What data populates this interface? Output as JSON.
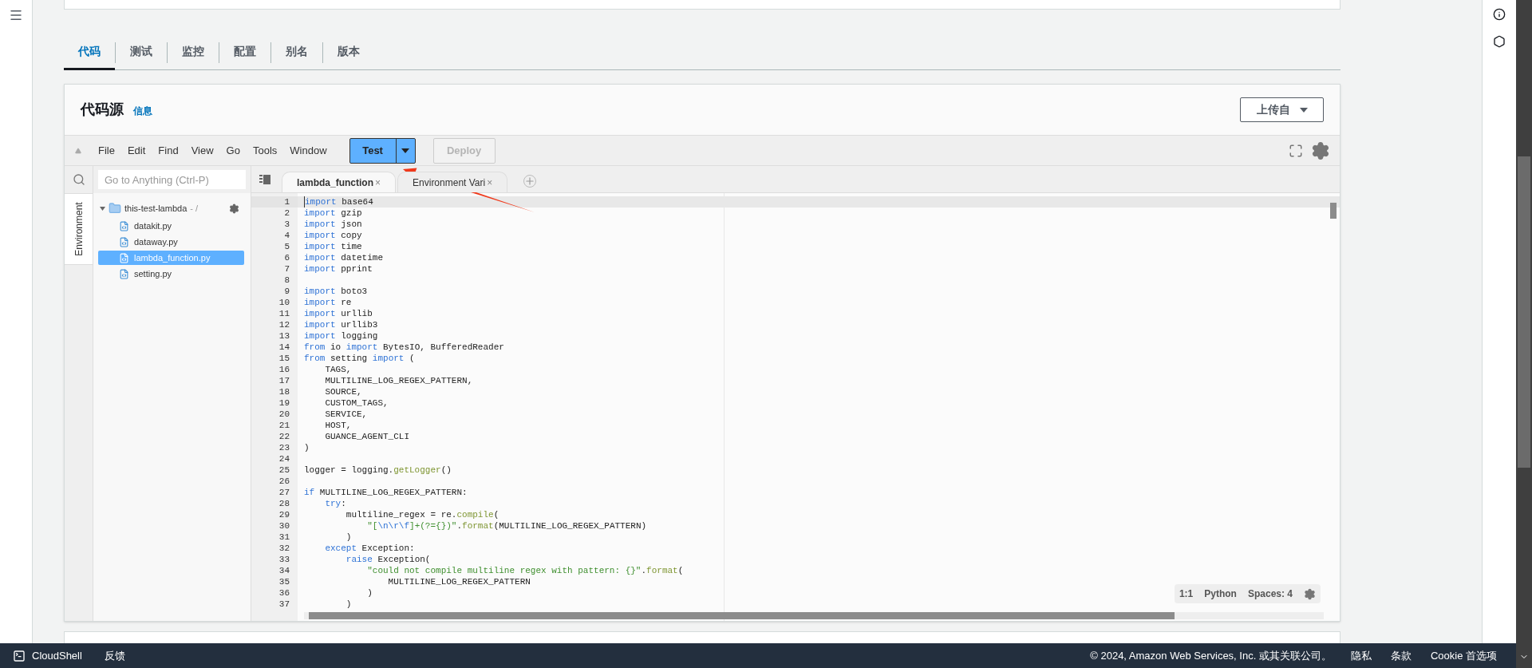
{
  "tabs": [
    {
      "label": "代码",
      "selected": true
    },
    {
      "label": "测试",
      "selected": false
    },
    {
      "label": "监控",
      "selected": false
    },
    {
      "label": "配置",
      "selected": false
    },
    {
      "label": "别名",
      "selected": false
    },
    {
      "label": "版本",
      "selected": false
    }
  ],
  "code_source": {
    "title": "代码源",
    "info_link": "信息",
    "upload_button": "上传自"
  },
  "ide": {
    "menu": [
      "File",
      "Edit",
      "Find",
      "View",
      "Go",
      "Tools",
      "Window"
    ],
    "test_button": "Test",
    "deploy_button": {
      "label": "Deploy",
      "disabled": true
    },
    "search": {
      "placeholder": "Go to Anything (Ctrl-P)"
    },
    "side_tab": "Environment",
    "tree": {
      "name": "this-test-lambda",
      "path": "- /",
      "expanded": true,
      "children": [
        {
          "name": "datakit.py",
          "selected": false
        },
        {
          "name": "dataway.py",
          "selected": false
        },
        {
          "name": "lambda_function.py",
          "selected": true
        },
        {
          "name": "setting.py",
          "selected": false
        }
      ]
    },
    "editor_tabs": [
      {
        "label": "lambda_function",
        "close": "×",
        "selected": true
      },
      {
        "label": "Environment Vari",
        "close": "×",
        "selected": false
      }
    ],
    "lines": [
      {
        "number": "1",
        "active": true,
        "tokens": [
          {
            "kind": "kw",
            "text": "import"
          },
          {
            "kind": "p",
            "text": " base64"
          }
        ]
      },
      {
        "number": "2",
        "active": false,
        "tokens": [
          {
            "kind": "kw",
            "text": "import"
          },
          {
            "kind": "p",
            "text": " gzip"
          }
        ]
      },
      {
        "number": "3",
        "active": false,
        "tokens": [
          {
            "kind": "kw",
            "text": "import"
          },
          {
            "kind": "p",
            "text": " json"
          }
        ]
      },
      {
        "number": "4",
        "active": false,
        "tokens": [
          {
            "kind": "kw",
            "text": "import"
          },
          {
            "kind": "p",
            "text": " copy"
          }
        ]
      },
      {
        "number": "5",
        "active": false,
        "tokens": [
          {
            "kind": "kw",
            "text": "import"
          },
          {
            "kind": "p",
            "text": " time"
          }
        ]
      },
      {
        "number": "6",
        "active": false,
        "tokens": [
          {
            "kind": "kw",
            "text": "import"
          },
          {
            "kind": "p",
            "text": " datetime"
          }
        ]
      },
      {
        "number": "7",
        "active": false,
        "tokens": [
          {
            "kind": "kw",
            "text": "import"
          },
          {
            "kind": "p",
            "text": " pprint"
          }
        ]
      },
      {
        "number": "8",
        "active": false
      },
      {
        "number": "9",
        "active": false,
        "tokens": [
          {
            "kind": "kw",
            "text": "import"
          },
          {
            "kind": "p",
            "text": " boto3"
          }
        ]
      },
      {
        "number": "10",
        "active": false,
        "tokens": [
          {
            "kind": "kw",
            "text": "import"
          },
          {
            "kind": "p",
            "text": " re"
          }
        ]
      },
      {
        "number": "11",
        "active": false,
        "tokens": [
          {
            "kind": "kw",
            "text": "import"
          },
          {
            "kind": "p",
            "text": " urllib"
          }
        ]
      },
      {
        "number": "12",
        "active": false,
        "tokens": [
          {
            "kind": "kw",
            "text": "import"
          },
          {
            "kind": "p",
            "text": " urllib3"
          }
        ]
      },
      {
        "number": "13",
        "active": false,
        "tokens": [
          {
            "kind": "kw",
            "text": "import"
          },
          {
            "kind": "p",
            "text": " logging"
          }
        ]
      },
      {
        "number": "14",
        "active": false,
        "tokens": [
          {
            "kind": "kw",
            "text": "from"
          },
          {
            "kind": "p",
            "text": " io "
          },
          {
            "kind": "kw",
            "text": "import"
          },
          {
            "kind": "p",
            "text": " BytesIO, BufferedReader"
          }
        ]
      },
      {
        "number": "15",
        "active": false,
        "tokens": [
          {
            "kind": "kw",
            "text": "from"
          },
          {
            "kind": "p",
            "text": " setting "
          },
          {
            "kind": "kw",
            "text": "import"
          },
          {
            "kind": "p",
            "text": " ("
          }
        ]
      },
      {
        "number": "16",
        "active": false,
        "tokens": [
          {
            "kind": "p",
            "text": "    TAGS,"
          }
        ]
      },
      {
        "number": "17",
        "active": false,
        "tokens": [
          {
            "kind": "p",
            "text": "    MULTILINE_LOG_REGEX_PATTERN,"
          }
        ]
      },
      {
        "number": "18",
        "active": false,
        "tokens": [
          {
            "kind": "p",
            "text": "    SOURCE,"
          }
        ]
      },
      {
        "number": "19",
        "active": false,
        "tokens": [
          {
            "kind": "p",
            "text": "    CUSTOM_TAGS,"
          }
        ]
      },
      {
        "number": "20",
        "active": false,
        "tokens": [
          {
            "kind": "p",
            "text": "    SERVICE,"
          }
        ]
      },
      {
        "number": "21",
        "active": false,
        "tokens": [
          {
            "kind": "p",
            "text": "    HOST,"
          }
        ]
      },
      {
        "number": "22",
        "active": false,
        "tokens": [
          {
            "kind": "p",
            "text": "    GUANCE_AGENT_CLI"
          }
        ]
      },
      {
        "number": "23",
        "active": false,
        "tokens": [
          {
            "kind": "p",
            "text": ")"
          }
        ]
      },
      {
        "number": "24",
        "active": false
      },
      {
        "number": "25",
        "active": false,
        "tokens": [
          {
            "kind": "p",
            "text": "logger = logging."
          },
          {
            "kind": "fn",
            "text": "getLogger"
          },
          {
            "kind": "p",
            "text": "()"
          }
        ]
      },
      {
        "number": "26",
        "active": false
      },
      {
        "number": "27",
        "active": false,
        "tokens": [
          {
            "kind": "kw",
            "text": "if"
          },
          {
            "kind": "p",
            "text": " MULTILINE_LOG_REGEX_PATTERN:"
          }
        ]
      },
      {
        "number": "28",
        "active": false,
        "tokens": [
          {
            "kind": "kw",
            "text": "    try"
          },
          {
            "kind": "p",
            "text": ":"
          }
        ]
      },
      {
        "number": "29",
        "active": false,
        "tokens": [
          {
            "kind": "p",
            "text": "        multiline_regex = re."
          },
          {
            "kind": "fn",
            "text": "compile"
          },
          {
            "kind": "p",
            "text": "("
          }
        ]
      },
      {
        "number": "30",
        "active": false,
        "tokens": [
          {
            "kind": "str",
            "text": "            \"["
          },
          {
            "kind": "esc",
            "text": "\\n\\r\\f"
          },
          {
            "kind": "str",
            "text": "]+(?={})\""
          },
          {
            "kind": "p",
            "text": "."
          },
          {
            "kind": "fn",
            "text": "format"
          },
          {
            "kind": "p",
            "text": "(MULTILINE_LOG_REGEX_PATTERN)"
          }
        ]
      },
      {
        "number": "31",
        "active": false,
        "tokens": [
          {
            "kind": "p",
            "text": "        )"
          }
        ]
      },
      {
        "number": "32",
        "active": false,
        "tokens": [
          {
            "kind": "kw",
            "text": "    except"
          },
          {
            "kind": "p",
            "text": " Exception:"
          }
        ]
      },
      {
        "number": "33",
        "active": false,
        "tokens": [
          {
            "kind": "kw",
            "text": "        raise"
          },
          {
            "kind": "p",
            "text": " Exception("
          }
        ]
      },
      {
        "number": "34",
        "active": false,
        "tokens": [
          {
            "kind": "str",
            "text": "            \"could not compile multiline regex with pattern: {}\""
          },
          {
            "kind": "p",
            "text": "."
          },
          {
            "kind": "fn",
            "text": "format"
          },
          {
            "kind": "p",
            "text": "("
          }
        ]
      },
      {
        "number": "35",
        "active": false,
        "tokens": [
          {
            "kind": "p",
            "text": "                MULTILINE_LOG_REGEX_PATTERN"
          }
        ]
      },
      {
        "number": "36",
        "active": false,
        "tokens": [
          {
            "kind": "p",
            "text": "            )"
          }
        ]
      },
      {
        "number": "37",
        "active": false,
        "tokens": [
          {
            "kind": "p",
            "text": "        )"
          }
        ]
      }
    ],
    "status": {
      "position": "1:1",
      "language": "Python",
      "indent": "Spaces: 4"
    }
  },
  "footer": {
    "cloudshell": "CloudShell",
    "feedback": "反馈",
    "copyright": "© 2024, Amazon Web Services, Inc. 或其关联公司。",
    "links": [
      "隐私",
      "条款",
      "Cookie 首选项"
    ]
  }
}
